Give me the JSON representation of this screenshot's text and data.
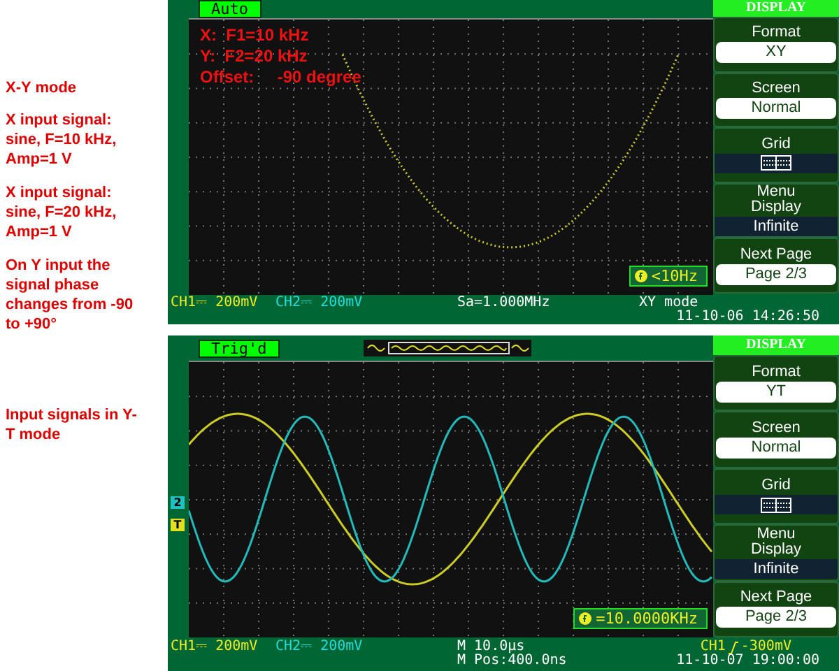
{
  "notes": [
    {
      "text": "X-Y mode"
    },
    {
      "text": "X input signal: sine, F=10 kHz, Amp=1 V"
    },
    {
      "text": "X input signal: sine, F=20 kHz, Amp=1 V"
    },
    {
      "text": "On Y input the signal phase changes from -90 to +90°"
    },
    {
      "text": "Input signals in Y-T mode"
    }
  ],
  "screens": [
    {
      "kind": "xy",
      "status": "Auto",
      "overlay": [
        "X:  F1=10 kHz",
        "Y:  F2=20 kHz",
        "Offset:     -90 degree"
      ],
      "frequency": "<10Hz",
      "menu": {
        "title": "DISPLAY",
        "items": [
          {
            "kind": "value",
            "label": "Format",
            "value": "XY"
          },
          {
            "kind": "value",
            "label": "Screen",
            "value": "Normal"
          },
          {
            "kind": "grid",
            "label": "Grid"
          },
          {
            "kind": "dark",
            "label": "Menu Display",
            "value": "Infinite"
          },
          {
            "kind": "value",
            "label": "Next Page",
            "value": "Page 2/3"
          }
        ]
      },
      "status_bar": {
        "ch1": "CH1⎓ 200mV",
        "ch2": "CH2⎓ 200mV",
        "middle": [
          "Sa=1.000MHz"
        ],
        "right_top": "XY mode",
        "time": "11-10-06 14:26:50"
      }
    },
    {
      "kind": "yt",
      "status": "Trig'd",
      "markers": [
        {
          "label": "2",
          "color": "#20c0c0"
        },
        {
          "label": "T",
          "color": "#e0e020"
        }
      ],
      "frequency": "=10.0000KHz",
      "menu": {
        "title": "DISPLAY",
        "items": [
          {
            "kind": "value",
            "label": "Format",
            "value": "YT"
          },
          {
            "kind": "value",
            "label": "Screen",
            "value": "Normal"
          },
          {
            "kind": "grid",
            "label": "Grid"
          },
          {
            "kind": "dark",
            "label": "Menu Display",
            "value": "Infinite"
          },
          {
            "kind": "value",
            "label": "Next Page",
            "value": "Page 2/3"
          }
        ]
      },
      "status_bar": {
        "ch1": "CH1⎓ 200mV",
        "ch2": "CH2⎓ 200mV",
        "middle": [
          "M 10.0μs",
          "M Pos:400.0ns"
        ],
        "trigger_source": "CH1",
        "trigger_level": "-300mV",
        "time": "11-10-07 19:00:00"
      }
    }
  ]
}
